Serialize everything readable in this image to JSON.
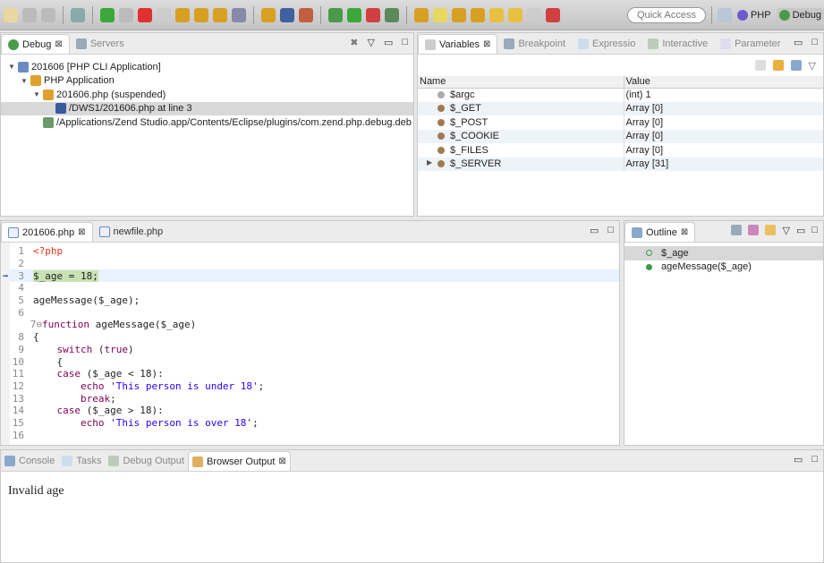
{
  "toolbar": {
    "quick_access": "Quick Access",
    "perspectives": [
      {
        "label": "PHP"
      },
      {
        "label": "Debug"
      }
    ],
    "icons": [
      "new-icon",
      "save-icon",
      "save-all-icon",
      "skip-breakpoints-icon",
      "resume-icon",
      "suspend-icon",
      "terminate-icon",
      "disconnect-icon",
      "step-into-icon",
      "step-over-icon",
      "step-return-icon",
      "drop-to-frame-icon",
      "use-step-filters-icon",
      "zend-icon",
      "library-icon",
      "debug-icon",
      "run-icon",
      "external-tools-icon",
      "php-web-icon",
      "edit-icon",
      "highlight-icon",
      "next-annotation-icon",
      "prev-annotation-icon",
      "back-icon",
      "back-arrow-icon",
      "forward-icon",
      "pin-icon"
    ],
    "colors": {
      "resume": "#3aa83a",
      "terminate": "#e03030"
    }
  },
  "debug": {
    "tabs": [
      {
        "label": "Debug"
      },
      {
        "label": "Servers"
      }
    ],
    "tree": [
      {
        "label": "201606 [PHP CLI Application]",
        "indent": 0
      },
      {
        "label": "PHP Application",
        "indent": 1
      },
      {
        "label": "201606.php (suspended)",
        "indent": 2
      },
      {
        "label": "/DWS1/201606.php at line 3",
        "indent": 3,
        "selected": true
      },
      {
        "label": "/Applications/Zend Studio.app/Contents/Eclipse/plugins/com.zend.php.debug.deb",
        "indent": 2
      }
    ]
  },
  "variables": {
    "tabs": [
      {
        "label": "Variables"
      },
      {
        "label": "Breakpoint"
      },
      {
        "label": "Expressio"
      },
      {
        "label": "Interactive"
      },
      {
        "label": "Parameter"
      }
    ],
    "columns": [
      "Name",
      "Value"
    ],
    "rows": [
      {
        "name": "$argc",
        "value": "(int) 1"
      },
      {
        "name": "$_GET",
        "value": "Array [0]"
      },
      {
        "name": "$_POST",
        "value": "Array [0]"
      },
      {
        "name": "$_COOKIE",
        "value": "Array [0]"
      },
      {
        "name": "$_FILES",
        "value": "Array [0]"
      },
      {
        "name": "$_SERVER",
        "value": "Array [31]"
      }
    ]
  },
  "editor": {
    "tabs": [
      {
        "label": "201606.php"
      },
      {
        "label": "newfile.php"
      }
    ],
    "current_line": 3,
    "lines": [
      [
        {
          "t": "<?php",
          "c": "php"
        }
      ],
      [],
      [
        {
          "t": "$_age = 18;",
          "c": "hl"
        }
      ],
      [],
      [
        {
          "t": "ageMessage($_age);",
          "c": "va"
        }
      ],
      [],
      [
        {
          "t": "function",
          "c": "kw"
        },
        {
          "t": " ageMessage($_age)",
          "c": "va"
        }
      ],
      [
        {
          "t": "{",
          "c": "va"
        }
      ],
      [
        {
          "t": "    "
        },
        {
          "t": "switch",
          "c": "kw"
        },
        {
          "t": " (",
          "c": "va"
        },
        {
          "t": "true",
          "c": "kw"
        },
        {
          "t": ")",
          "c": "va"
        }
      ],
      [
        {
          "t": "    {",
          "c": "va"
        }
      ],
      [
        {
          "t": "    "
        },
        {
          "t": "case",
          "c": "kw"
        },
        {
          "t": " ($_age < 18):",
          "c": "va"
        }
      ],
      [
        {
          "t": "        "
        },
        {
          "t": "echo",
          "c": "kw"
        },
        {
          "t": " 'This person is under 18'",
          "c": "str"
        },
        {
          "t": ";",
          "c": "va"
        }
      ],
      [
        {
          "t": "        "
        },
        {
          "t": "break",
          "c": "kw"
        },
        {
          "t": ";",
          "c": "va"
        }
      ],
      [
        {
          "t": "    "
        },
        {
          "t": "case",
          "c": "kw"
        },
        {
          "t": " ($_age > 18):",
          "c": "va"
        }
      ],
      [
        {
          "t": "        "
        },
        {
          "t": "echo",
          "c": "kw"
        },
        {
          "t": " 'This person is over 18'",
          "c": "str"
        },
        {
          "t": ";",
          "c": "va"
        }
      ],
      []
    ]
  },
  "outline": {
    "title": "Outline",
    "items": [
      {
        "label": "$_age"
      },
      {
        "label": "ageMessage($_age)"
      }
    ]
  },
  "bottom": {
    "tabs": [
      {
        "label": "Console"
      },
      {
        "label": "Tasks"
      },
      {
        "label": "Debug Output"
      },
      {
        "label": "Browser Output"
      }
    ],
    "output": "Invalid age"
  }
}
